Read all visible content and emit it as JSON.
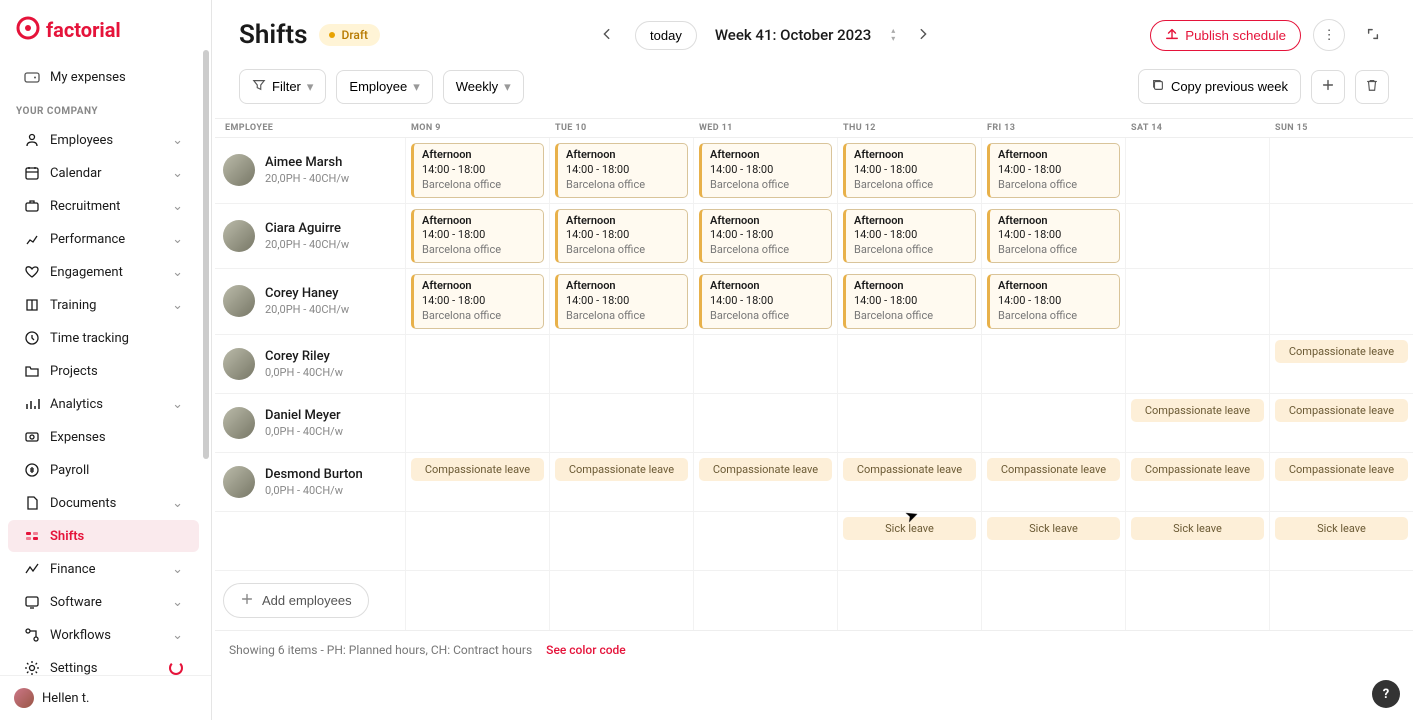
{
  "brand": "factorial",
  "sidebar": {
    "top_item": "My expenses",
    "section": "YOUR COMPANY",
    "items": [
      {
        "label": "Employees",
        "icon": "people",
        "expandable": true
      },
      {
        "label": "Calendar",
        "icon": "calendar",
        "expandable": true
      },
      {
        "label": "Recruitment",
        "icon": "briefcase",
        "expandable": true
      },
      {
        "label": "Performance",
        "icon": "chart",
        "expandable": true
      },
      {
        "label": "Engagement",
        "icon": "heart",
        "expandable": true
      },
      {
        "label": "Training",
        "icon": "book",
        "expandable": true
      },
      {
        "label": "Time tracking",
        "icon": "clock",
        "expandable": false
      },
      {
        "label": "Projects",
        "icon": "folder",
        "expandable": false
      },
      {
        "label": "Analytics",
        "icon": "bar",
        "expandable": true
      },
      {
        "label": "Expenses",
        "icon": "expense",
        "expandable": false
      },
      {
        "label": "Payroll",
        "icon": "payroll",
        "expandable": false
      },
      {
        "label": "Documents",
        "icon": "doc",
        "expandable": true
      },
      {
        "label": "Shifts",
        "icon": "shifts",
        "expandable": false,
        "active": true
      },
      {
        "label": "Finance",
        "icon": "finance",
        "expandable": true
      },
      {
        "label": "Software",
        "icon": "software",
        "expandable": true
      },
      {
        "label": "Workflows",
        "icon": "workflow",
        "expandable": true
      },
      {
        "label": "Settings",
        "icon": "gear",
        "expandable": false,
        "spinner": true
      }
    ],
    "user": "Hellen t."
  },
  "header": {
    "title": "Shifts",
    "status": "Draft",
    "today": "today",
    "period": "Week 41: October 2023",
    "publish": "Publish schedule"
  },
  "toolbar": {
    "filter": "Filter",
    "group": "Employee",
    "range": "Weekly",
    "copy": "Copy previous week"
  },
  "grid": {
    "header_employee": "EMPLOYEE",
    "days": [
      "MON 9",
      "TUE 10",
      "WED 11",
      "THU 12",
      "FRI 13",
      "SAT 14",
      "SUN 15"
    ],
    "shift": {
      "title": "Afternoon",
      "time": "14:00 - 18:00",
      "loc": "Barcelona office"
    },
    "leave_comp": "Compassionate leave",
    "leave_sick": "Sick leave",
    "employees": [
      {
        "name": "Aimee Marsh",
        "sub": "20,0PH - 40CH/w",
        "shifts": [
          true,
          true,
          true,
          true,
          true,
          false,
          false
        ]
      },
      {
        "name": "Ciara Aguirre",
        "sub": "20,0PH - 40CH/w",
        "shifts": [
          true,
          true,
          true,
          true,
          true,
          false,
          false
        ]
      },
      {
        "name": "Corey Haney",
        "sub": "20,0PH - 40CH/w",
        "shifts": [
          true,
          true,
          true,
          true,
          true,
          false,
          false
        ]
      },
      {
        "name": "Corey Riley",
        "sub": "0,0PH - 40CH/w",
        "comp": [
          false,
          false,
          false,
          false,
          false,
          false,
          true
        ]
      },
      {
        "name": "Daniel Meyer",
        "sub": "0,0PH - 40CH/w",
        "comp": [
          false,
          false,
          false,
          false,
          false,
          true,
          true
        ]
      },
      {
        "name": "Desmond Burton",
        "sub": "0,0PH - 40CH/w",
        "comp": [
          true,
          true,
          true,
          true,
          true,
          true,
          true
        ]
      }
    ],
    "sick_row": [
      false,
      false,
      false,
      true,
      true,
      true,
      true
    ],
    "add_emp": "Add employees"
  },
  "status": {
    "summary": "Showing 6 items - PH: Planned hours, CH: Contract hours",
    "link": "See color code"
  }
}
